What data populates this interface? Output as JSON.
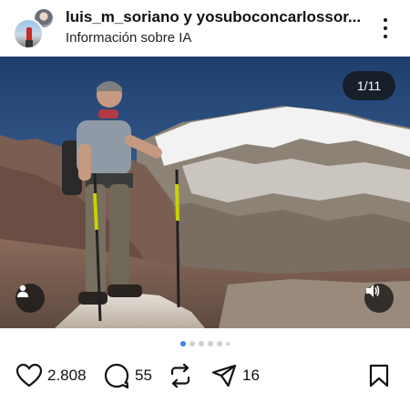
{
  "header": {
    "title": "luis_m_soriano y yosuboconcarlossor...",
    "subtitle": "Información sobre IA",
    "avatar_icon": "avatar-icon",
    "more_icon": "more-vertical-icon"
  },
  "media": {
    "counter": "1/11",
    "tag_icon": "user-tag-icon",
    "sound_icon": "speaker-icon"
  },
  "pagination": {
    "active_index": 0,
    "dots": 6
  },
  "actions": {
    "like_count": "2.808",
    "comment_count": "55",
    "share_count": "16",
    "like_icon": "heart-icon",
    "comment_icon": "comment-icon",
    "repost_icon": "repost-icon",
    "share_icon": "send-icon",
    "save_icon": "bookmark-icon"
  },
  "colors": {
    "accent": "#3b82f6",
    "overlay": "#141414"
  }
}
